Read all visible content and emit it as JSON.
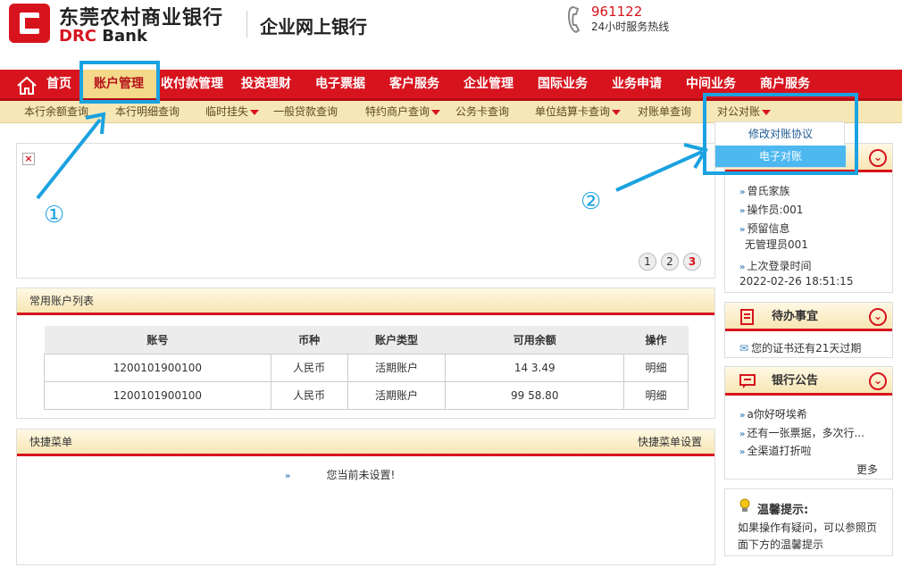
{
  "header": {
    "bank_name_cn": "东莞农村商业银行",
    "bank_name_en_prefix": "DRC",
    "bank_name_en_suffix": " Bank",
    "portal_title": "企业网上银行",
    "hotline_number": "961122",
    "hotline_label": "24小时服务热线"
  },
  "main_nav": {
    "items": [
      "首页",
      "账户管理",
      "收付款管理",
      "投资理财",
      "电子票据",
      "客户服务",
      "企业管理",
      "国际业务",
      "业务申请",
      "中间业务",
      "商户服务"
    ],
    "active": "账户管理"
  },
  "sub_nav": {
    "items": [
      "本行余额查询",
      "本行明细查询",
      "临时挂失",
      "一般贷款查询",
      "特约商户查询",
      "公务卡查询",
      "单位结算卡查询",
      "对账单查询",
      "对公对账"
    ],
    "dropdown": [
      "修改对账协议",
      "电子对账"
    ],
    "dropdown_highlight": "电子对账"
  },
  "annotations": {
    "step1": "①",
    "step2": "②"
  },
  "banner": {
    "broken_image": "×",
    "pages": [
      "1",
      "2",
      "3"
    ],
    "current_page": "3"
  },
  "accounts": {
    "title": "常用账户列表",
    "columns": [
      "账号",
      "币种",
      "账户类型",
      "可用余额",
      "操作"
    ],
    "rows": [
      {
        "account": "1200101900100",
        "currency": "人民币",
        "type": "活期账户",
        "balance": "14 3.49",
        "action": "明细"
      },
      {
        "account": "1200101900100",
        "currency": "人民币",
        "type": "活期账户",
        "balance": "99 58.80",
        "action": "明细"
      }
    ]
  },
  "quick_menu": {
    "title": "快捷菜单",
    "settings_label": "快捷菜单设置",
    "empty_text": "您当前未设置!"
  },
  "user_info": {
    "name": "曾氏家族",
    "operator": "操作员:001",
    "reserved_label": "预留信息",
    "reserved_value": "无管理员001",
    "last_login_label": "上次登录时间",
    "last_login_value": "2022-02-26 18:51:15"
  },
  "todo": {
    "title": "待办事宜",
    "item": "您的证书还有21天过期"
  },
  "notice": {
    "title": "银行公告",
    "items": [
      "a你好呀埃希",
      "还有一张票据，多次行...",
      "全渠道打折啦"
    ],
    "more": "更多"
  },
  "tips": {
    "title": "温馨提示:",
    "body": "如果操作有疑问，可以参照页面下方的温馨提示"
  },
  "colors": {
    "brand_red": "#d7141e",
    "annotation_blue": "#1ba2e0",
    "subnav_bg": "#f6e7b7"
  }
}
